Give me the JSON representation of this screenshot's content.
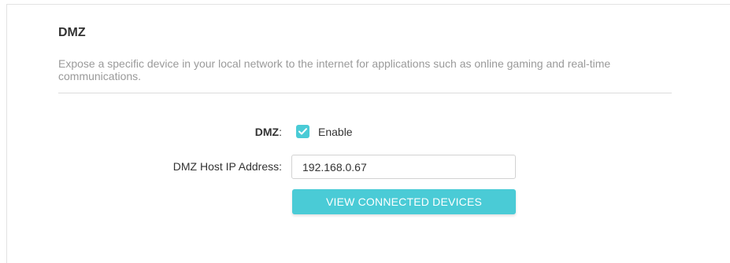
{
  "section": {
    "title": "DMZ",
    "description": "Expose a specific device in your local network to the internet for applications such as online gaming and real-time communications."
  },
  "form": {
    "dmz_label": "DMZ",
    "dmz_colon": ":",
    "enable_label": "Enable",
    "enable_checked": true,
    "ip_label": "DMZ Host IP Address:",
    "ip_value": "192.168.0.67",
    "view_button_label": "VIEW CONNECTED DEVICES"
  },
  "colors": {
    "accent": "#4acbd6",
    "title_text": "#333333",
    "description_text": "#9a9a9a"
  },
  "icons": {
    "checkbox": "check-icon"
  }
}
